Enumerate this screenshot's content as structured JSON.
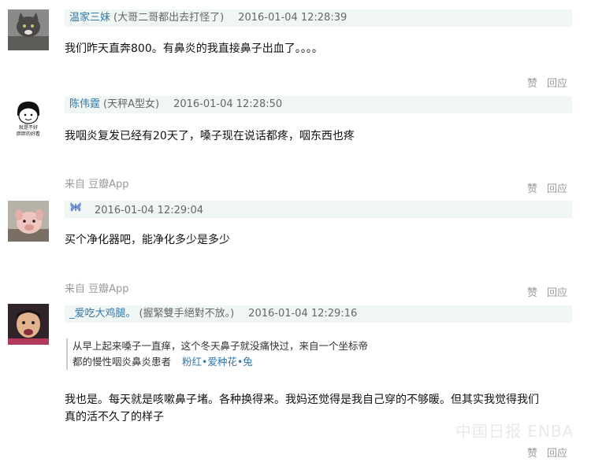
{
  "comments": [
    {
      "name": "温家三妹",
      "signature": "(大哥二哥都出去打怪了)",
      "time": "2016-01-04 12:28:39",
      "text": "我们昨天直奔800。有鼻炎的我直接鼻子出血了。。。。",
      "actions": {
        "like": "赞",
        "reply": "回应"
      }
    },
    {
      "name": "陈伟霆",
      "signature": "(天秤A型女)",
      "time": "2016-01-04 12:28:50",
      "text": "我咽炎复发已经有20天了，嗓子现在说话都疼，咽东西也疼",
      "from": "来自 豆瓣App",
      "avatar_caption_1": "就是不好",
      "avatar_caption_2": "胖胖的好看",
      "actions": {
        "like": "赞",
        "reply": "回应"
      }
    },
    {
      "name": "",
      "signature": "",
      "time": "2016-01-04 12:29:04",
      "text": "买个净化器吧，能净化多少是多少",
      "from": "来自 豆瓣App",
      "badge_icon": "butterfly-icon",
      "actions": {
        "like": "赞",
        "reply": "回应"
      }
    },
    {
      "name": "_爱吃大鸡腿。",
      "signature": "(握緊雙手絕對不放。)",
      "time": "2016-01-04 12:29:16",
      "quote": {
        "line1": "从早上起来嗓子一直痒，这个冬天鼻子就没痛快过，来自一个坐标帝",
        "line2": "都的慢性咽炎鼻炎患者",
        "tags": "粉红•爱种花•兔"
      },
      "text_line1": "我也是。每天就是咳嗽鼻子堵。各种换得来。我妈还觉得是我自己穿的不够暖。但其实我觉得我们",
      "text_line2": "真的活不久了的样子",
      "actions": {
        "like": "赞",
        "reply": "回应"
      }
    }
  ],
  "watermark": "中国日报 ENBA",
  "colors": {
    "meta_bg": "#f0f6f3",
    "link": "#3377aa",
    "muted": "#999999"
  }
}
